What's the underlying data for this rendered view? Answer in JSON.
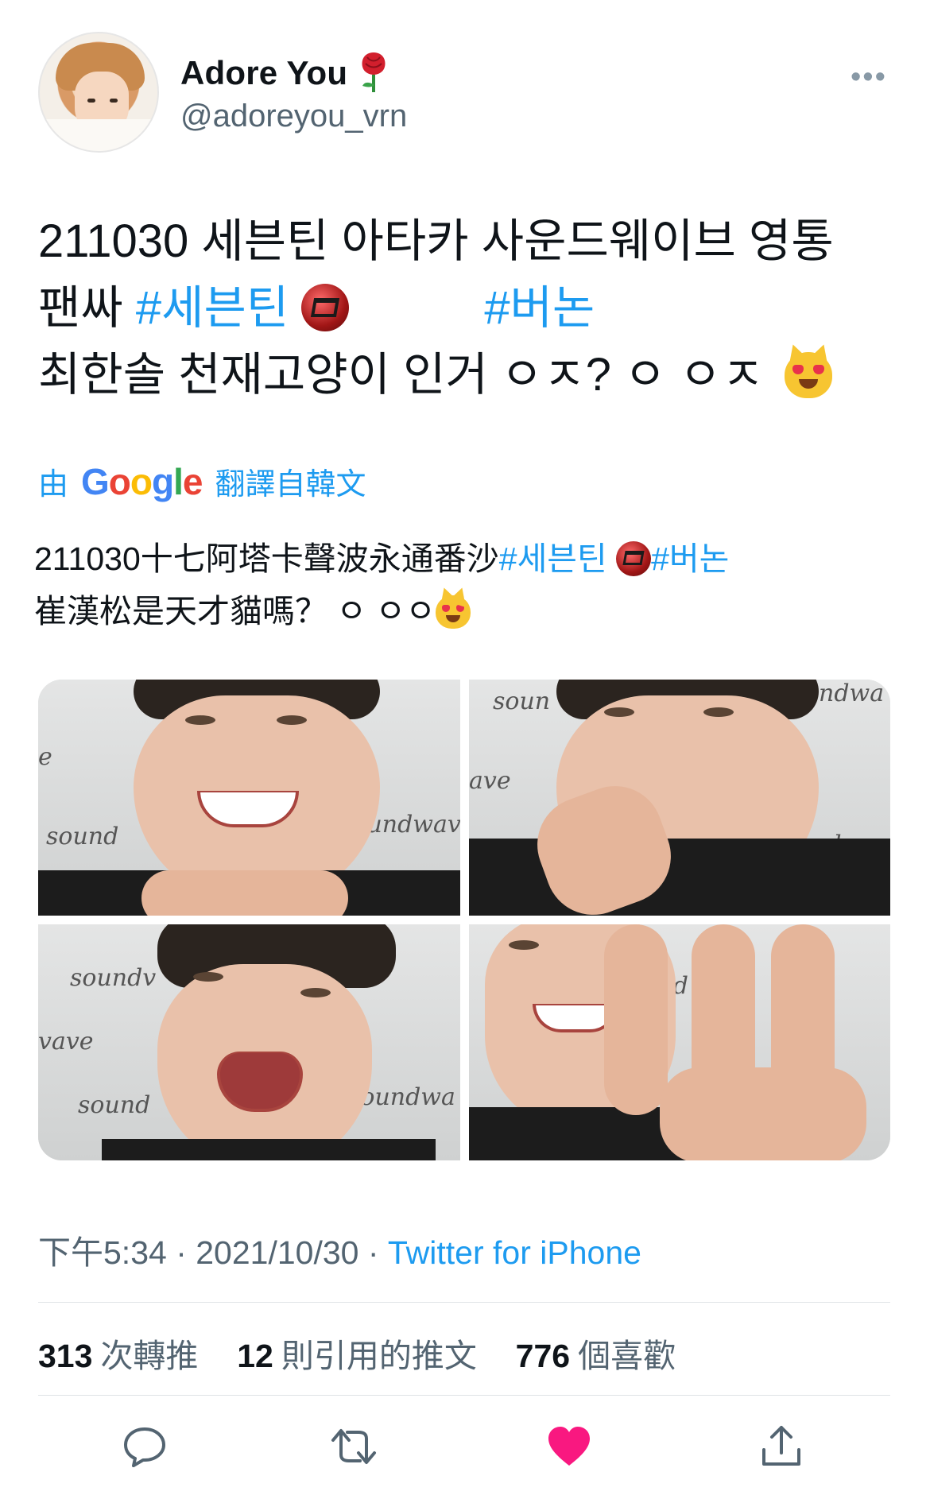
{
  "author": {
    "name": "Adore You",
    "handle": "@adoreyou_vrn",
    "name_emoji": "rose-icon"
  },
  "tweet": {
    "line1": "211030 세븐틴 아타카 사운드웨이브 영통",
    "line2_text": "팬싸 ",
    "hashtag1": "#세븐틴",
    "hashtag2": "#버논",
    "line3_text": "최한솔 천재고양이 인거 ㅇㅈ? ㅇ ㅇㅈ "
  },
  "translation": {
    "prefix": "由",
    "provider": "Google",
    "label": "翻譯自韓文",
    "line1_text": "211030十七阿塔卡聲波永通番沙",
    "hashtag1": "#세븐틴",
    "hashtag2": "#버논",
    "line2_text": "崔漢松是天才貓嗎？ ㅇ ㅇㅇ"
  },
  "media": {
    "photos": [
      {
        "id": "photo-1",
        "watermark": [
          "sound",
          "soundwav",
          "e"
        ]
      },
      {
        "id": "photo-2",
        "watermark": [
          "soun",
          "ave",
          "sou",
          "ndwa",
          "ndwa"
        ]
      },
      {
        "id": "photo-3",
        "watermark": [
          "soundv",
          "vave",
          "sound",
          "soundwa"
        ]
      },
      {
        "id": "photo-4",
        "watermark": [
          "ound",
          "s"
        ]
      }
    ]
  },
  "meta": {
    "time": "下午5:34",
    "date": "2021/10/30",
    "separator": " · ",
    "source": "Twitter for iPhone"
  },
  "stats": {
    "retweets_count": "313",
    "retweets_label": "次轉推",
    "quotes_count": "12",
    "quotes_label": "則引用的推文",
    "likes_count": "776",
    "likes_label": "個喜歡"
  },
  "actions": {
    "reply": "reply-icon",
    "retweet": "retweet-icon",
    "like": "heart-icon",
    "share": "share-icon",
    "like_color": "#f91880",
    "icon_color": "#536471"
  },
  "colors": {
    "link": "#1d9bf0",
    "secondary_text": "#536471",
    "primary_text": "#0f1419"
  }
}
